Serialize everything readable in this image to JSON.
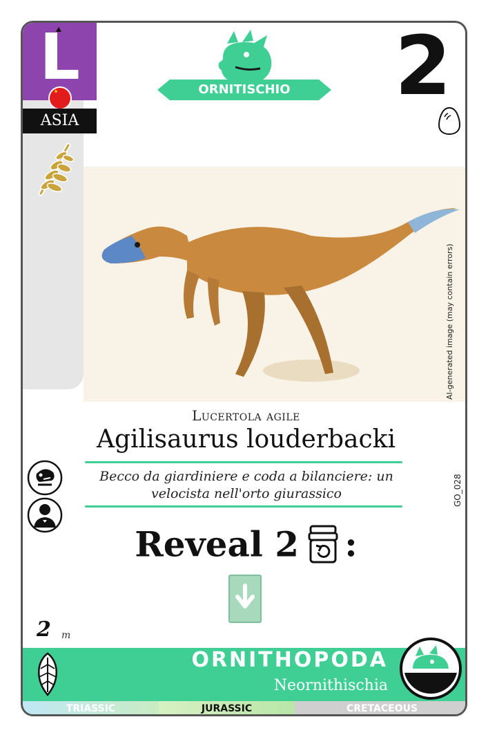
{
  "card": {
    "size_letter": "L",
    "region": "ASIA",
    "clade_banner": "ORNITISCHIO",
    "cost": "2",
    "ai_note": "AI-generated image (may contain errors)",
    "common_name": "Lucertola agile",
    "scientific_name": "Agilisaurus louderbacki",
    "flavor_line1": "Becco da giardiniere e coda a bilanciere: un",
    "flavor_line2": "velocista nell'orto giurassico",
    "set_code": "GO_028",
    "ability_text": "Reveal 2",
    "ability_colon": ":",
    "length_value": "2",
    "length_unit": "m",
    "order": "ORNITHOPODA",
    "suborder": "Neornithischia",
    "periods": [
      "TRIASSIC",
      "JURASSIC",
      "CRETACEOUS"
    ],
    "active_period": "JURASSIC"
  },
  "colors": {
    "accent_green": "#3fcf95",
    "size_purple": "#8e44ad",
    "region_black": "#111111",
    "card_border": "#555555"
  },
  "icons": {
    "clade": "triceratops-head-icon",
    "diet": "fern-leaf-icon",
    "egg": "egg-icon",
    "trait_1": "bone-fight-icon",
    "trait_2": "gentleman-silhouette-icon",
    "ability": "deck-reveal-icon",
    "effect": "green-card-down-arrow-icon",
    "foot": "leaf-feather-icon",
    "badge": "triceratops-badge-icon"
  }
}
